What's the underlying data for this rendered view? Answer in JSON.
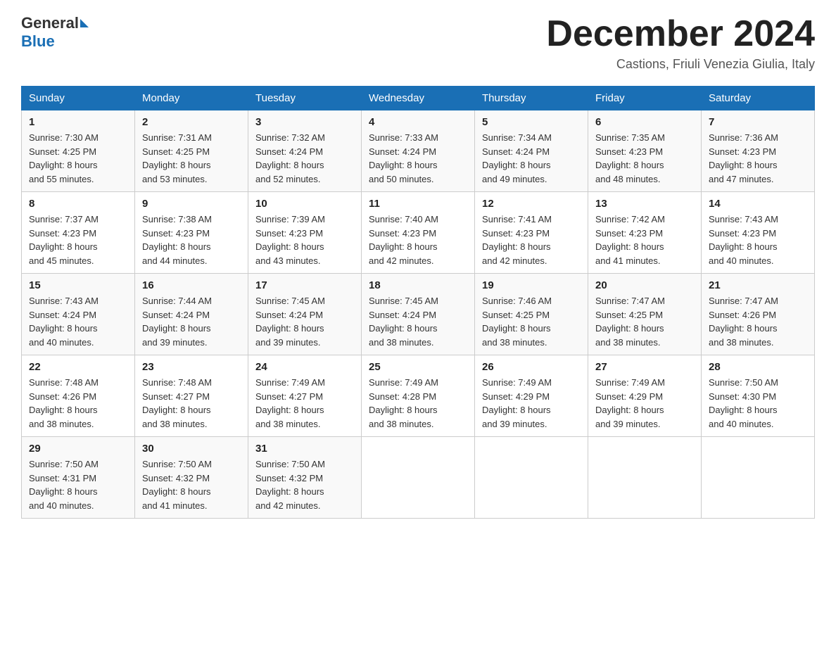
{
  "header": {
    "logo_general": "General",
    "logo_blue": "Blue",
    "month_title": "December 2024",
    "location": "Castions, Friuli Venezia Giulia, Italy"
  },
  "days_of_week": [
    "Sunday",
    "Monday",
    "Tuesday",
    "Wednesday",
    "Thursday",
    "Friday",
    "Saturday"
  ],
  "weeks": [
    [
      {
        "day": "1",
        "sunrise": "7:30 AM",
        "sunset": "4:25 PM",
        "daylight": "8 hours and 55 minutes."
      },
      {
        "day": "2",
        "sunrise": "7:31 AM",
        "sunset": "4:25 PM",
        "daylight": "8 hours and 53 minutes."
      },
      {
        "day": "3",
        "sunrise": "7:32 AM",
        "sunset": "4:24 PM",
        "daylight": "8 hours and 52 minutes."
      },
      {
        "day": "4",
        "sunrise": "7:33 AM",
        "sunset": "4:24 PM",
        "daylight": "8 hours and 50 minutes."
      },
      {
        "day": "5",
        "sunrise": "7:34 AM",
        "sunset": "4:24 PM",
        "daylight": "8 hours and 49 minutes."
      },
      {
        "day": "6",
        "sunrise": "7:35 AM",
        "sunset": "4:23 PM",
        "daylight": "8 hours and 48 minutes."
      },
      {
        "day": "7",
        "sunrise": "7:36 AM",
        "sunset": "4:23 PM",
        "daylight": "8 hours and 47 minutes."
      }
    ],
    [
      {
        "day": "8",
        "sunrise": "7:37 AM",
        "sunset": "4:23 PM",
        "daylight": "8 hours and 45 minutes."
      },
      {
        "day": "9",
        "sunrise": "7:38 AM",
        "sunset": "4:23 PM",
        "daylight": "8 hours and 44 minutes."
      },
      {
        "day": "10",
        "sunrise": "7:39 AM",
        "sunset": "4:23 PM",
        "daylight": "8 hours and 43 minutes."
      },
      {
        "day": "11",
        "sunrise": "7:40 AM",
        "sunset": "4:23 PM",
        "daylight": "8 hours and 42 minutes."
      },
      {
        "day": "12",
        "sunrise": "7:41 AM",
        "sunset": "4:23 PM",
        "daylight": "8 hours and 42 minutes."
      },
      {
        "day": "13",
        "sunrise": "7:42 AM",
        "sunset": "4:23 PM",
        "daylight": "8 hours and 41 minutes."
      },
      {
        "day": "14",
        "sunrise": "7:43 AM",
        "sunset": "4:23 PM",
        "daylight": "8 hours and 40 minutes."
      }
    ],
    [
      {
        "day": "15",
        "sunrise": "7:43 AM",
        "sunset": "4:24 PM",
        "daylight": "8 hours and 40 minutes."
      },
      {
        "day": "16",
        "sunrise": "7:44 AM",
        "sunset": "4:24 PM",
        "daylight": "8 hours and 39 minutes."
      },
      {
        "day": "17",
        "sunrise": "7:45 AM",
        "sunset": "4:24 PM",
        "daylight": "8 hours and 39 minutes."
      },
      {
        "day": "18",
        "sunrise": "7:45 AM",
        "sunset": "4:24 PM",
        "daylight": "8 hours and 38 minutes."
      },
      {
        "day": "19",
        "sunrise": "7:46 AM",
        "sunset": "4:25 PM",
        "daylight": "8 hours and 38 minutes."
      },
      {
        "day": "20",
        "sunrise": "7:47 AM",
        "sunset": "4:25 PM",
        "daylight": "8 hours and 38 minutes."
      },
      {
        "day": "21",
        "sunrise": "7:47 AM",
        "sunset": "4:26 PM",
        "daylight": "8 hours and 38 minutes."
      }
    ],
    [
      {
        "day": "22",
        "sunrise": "7:48 AM",
        "sunset": "4:26 PM",
        "daylight": "8 hours and 38 minutes."
      },
      {
        "day": "23",
        "sunrise": "7:48 AM",
        "sunset": "4:27 PM",
        "daylight": "8 hours and 38 minutes."
      },
      {
        "day": "24",
        "sunrise": "7:49 AM",
        "sunset": "4:27 PM",
        "daylight": "8 hours and 38 minutes."
      },
      {
        "day": "25",
        "sunrise": "7:49 AM",
        "sunset": "4:28 PM",
        "daylight": "8 hours and 38 minutes."
      },
      {
        "day": "26",
        "sunrise": "7:49 AM",
        "sunset": "4:29 PM",
        "daylight": "8 hours and 39 minutes."
      },
      {
        "day": "27",
        "sunrise": "7:49 AM",
        "sunset": "4:29 PM",
        "daylight": "8 hours and 39 minutes."
      },
      {
        "day": "28",
        "sunrise": "7:50 AM",
        "sunset": "4:30 PM",
        "daylight": "8 hours and 40 minutes."
      }
    ],
    [
      {
        "day": "29",
        "sunrise": "7:50 AM",
        "sunset": "4:31 PM",
        "daylight": "8 hours and 40 minutes."
      },
      {
        "day": "30",
        "sunrise": "7:50 AM",
        "sunset": "4:32 PM",
        "daylight": "8 hours and 41 minutes."
      },
      {
        "day": "31",
        "sunrise": "7:50 AM",
        "sunset": "4:32 PM",
        "daylight": "8 hours and 42 minutes."
      },
      null,
      null,
      null,
      null
    ]
  ],
  "labels": {
    "sunrise": "Sunrise:",
    "sunset": "Sunset:",
    "daylight": "Daylight:"
  }
}
